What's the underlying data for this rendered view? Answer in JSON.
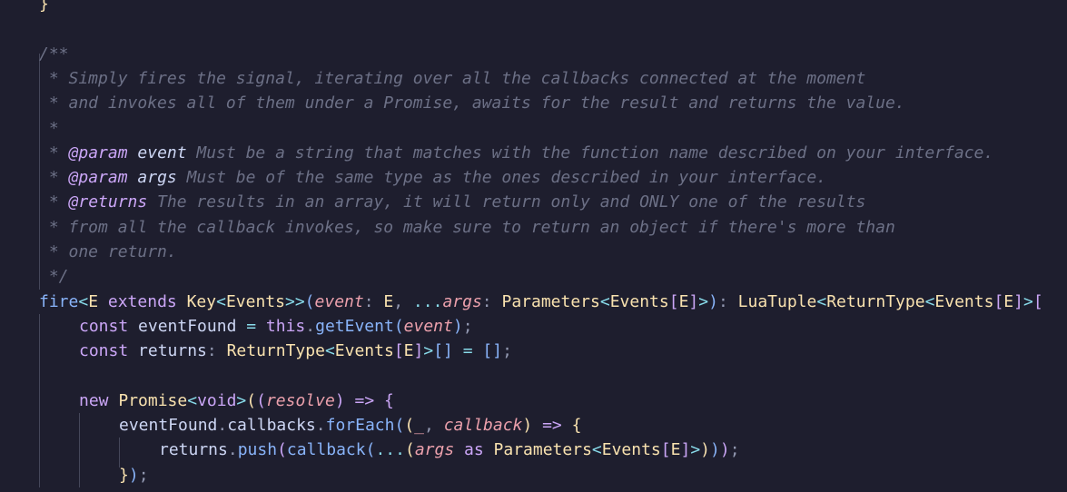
{
  "colors": {
    "background": "#1e1e2e",
    "comment": "#6c7086",
    "keyword": "#cba6f7",
    "function": "#89b4fa",
    "type": "#f9e2af",
    "parameter": "#eba0ac",
    "text": "#cdd6f4",
    "operator": "#89dceb"
  },
  "lines": [
    {
      "indent": 0,
      "tokens": [
        {
          "t": "}",
          "c": "tok-brace-y"
        }
      ]
    },
    {
      "indent": 0,
      "tokens": []
    },
    {
      "indent": 0,
      "tokens": [
        {
          "t": "/**",
          "c": "tok-comment"
        }
      ]
    },
    {
      "indent": 0,
      "tokens": [
        {
          "t": " * Simply fires the signal, iterating over all the callbacks connected at the moment",
          "c": "tok-comment"
        }
      ]
    },
    {
      "indent": 0,
      "tokens": [
        {
          "t": " * and invokes all of them under a Promise, awaits for the result and returns the value.",
          "c": "tok-comment"
        }
      ]
    },
    {
      "indent": 0,
      "tokens": [
        {
          "t": " *",
          "c": "tok-comment"
        }
      ]
    },
    {
      "indent": 0,
      "tokens": [
        {
          "t": " * ",
          "c": "tok-comment"
        },
        {
          "t": "@param",
          "c": "tok-tag"
        },
        {
          "t": " ",
          "c": "tok-comment"
        },
        {
          "t": "event",
          "c": "tok-param-name"
        },
        {
          "t": " Must be a string that matches with the function name described on your interface.",
          "c": "tok-comment"
        }
      ]
    },
    {
      "indent": 0,
      "tokens": [
        {
          "t": " * ",
          "c": "tok-comment"
        },
        {
          "t": "@param",
          "c": "tok-tag"
        },
        {
          "t": " ",
          "c": "tok-comment"
        },
        {
          "t": "args",
          "c": "tok-param-name"
        },
        {
          "t": " Must be of the same type as the ones described in your interface.",
          "c": "tok-comment"
        }
      ]
    },
    {
      "indent": 0,
      "tokens": [
        {
          "t": " * ",
          "c": "tok-comment"
        },
        {
          "t": "@returns",
          "c": "tok-tag"
        },
        {
          "t": " The results in an array, it will return only and ONLY one of the results",
          "c": "tok-comment"
        }
      ]
    },
    {
      "indent": 0,
      "tokens": [
        {
          "t": " * from all the callback invokes, so make sure to return an object if there's more than",
          "c": "tok-comment"
        }
      ]
    },
    {
      "indent": 0,
      "tokens": [
        {
          "t": " * one return.",
          "c": "tok-comment"
        }
      ]
    },
    {
      "indent": 0,
      "tokens": [
        {
          "t": " */",
          "c": "tok-comment"
        }
      ]
    },
    {
      "indent": 0,
      "tokens": [
        {
          "t": "fire",
          "c": "tok-function"
        },
        {
          "t": "<",
          "c": "tok-operator"
        },
        {
          "t": "E",
          "c": "tok-type"
        },
        {
          "t": " extends ",
          "c": "tok-keyword"
        },
        {
          "t": "Key",
          "c": "tok-type"
        },
        {
          "t": "<",
          "c": "tok-operator"
        },
        {
          "t": "Events",
          "c": "tok-type"
        },
        {
          "t": ">>",
          "c": "tok-operator"
        },
        {
          "t": "(",
          "c": "tok-brace-b"
        },
        {
          "t": "event",
          "c": "tok-param"
        },
        {
          "t": ": ",
          "c": "tok-punct"
        },
        {
          "t": "E",
          "c": "tok-type"
        },
        {
          "t": ", ",
          "c": "tok-punct"
        },
        {
          "t": "...",
          "c": "tok-operator"
        },
        {
          "t": "args",
          "c": "tok-param"
        },
        {
          "t": ": ",
          "c": "tok-punct"
        },
        {
          "t": "Parameters",
          "c": "tok-type"
        },
        {
          "t": "<",
          "c": "tok-operator"
        },
        {
          "t": "Events",
          "c": "tok-type"
        },
        {
          "t": "[",
          "c": "tok-brace-p"
        },
        {
          "t": "E",
          "c": "tok-type"
        },
        {
          "t": "]",
          "c": "tok-brace-p"
        },
        {
          "t": ">",
          "c": "tok-operator"
        },
        {
          "t": ")",
          "c": "tok-brace-b"
        },
        {
          "t": ": ",
          "c": "tok-punct"
        },
        {
          "t": "LuaTuple",
          "c": "tok-type"
        },
        {
          "t": "<",
          "c": "tok-operator"
        },
        {
          "t": "ReturnType",
          "c": "tok-type"
        },
        {
          "t": "<",
          "c": "tok-operator"
        },
        {
          "t": "Events",
          "c": "tok-type"
        },
        {
          "t": "[",
          "c": "tok-brace-p"
        },
        {
          "t": "E",
          "c": "tok-type"
        },
        {
          "t": "]",
          "c": "tok-brace-p"
        },
        {
          "t": ">",
          "c": "tok-operator"
        },
        {
          "t": "[",
          "c": "tok-brace-p"
        }
      ]
    },
    {
      "indent": 1,
      "tokens": [
        {
          "t": "const ",
          "c": "tok-keyword"
        },
        {
          "t": "eventFound",
          "c": "tok-plain"
        },
        {
          "t": " = ",
          "c": "tok-operator"
        },
        {
          "t": "this",
          "c": "tok-keyword"
        },
        {
          "t": ".",
          "c": "tok-punct"
        },
        {
          "t": "getEvent",
          "c": "tok-function"
        },
        {
          "t": "(",
          "c": "tok-brace-b"
        },
        {
          "t": "event",
          "c": "tok-param"
        },
        {
          "t": ")",
          "c": "tok-brace-b"
        },
        {
          "t": ";",
          "c": "tok-punct"
        }
      ]
    },
    {
      "indent": 1,
      "tokens": [
        {
          "t": "const ",
          "c": "tok-keyword"
        },
        {
          "t": "returns",
          "c": "tok-plain"
        },
        {
          "t": ": ",
          "c": "tok-punct"
        },
        {
          "t": "ReturnType",
          "c": "tok-type"
        },
        {
          "t": "<",
          "c": "tok-operator"
        },
        {
          "t": "Events",
          "c": "tok-type"
        },
        {
          "t": "[",
          "c": "tok-brace-p"
        },
        {
          "t": "E",
          "c": "tok-type"
        },
        {
          "t": "]",
          "c": "tok-brace-p"
        },
        {
          "t": ">",
          "c": "tok-operator"
        },
        {
          "t": "[]",
          "c": "tok-brace-b"
        },
        {
          "t": " = ",
          "c": "tok-operator"
        },
        {
          "t": "[]",
          "c": "tok-brace-b"
        },
        {
          "t": ";",
          "c": "tok-punct"
        }
      ]
    },
    {
      "indent": 1,
      "tokens": []
    },
    {
      "indent": 1,
      "tokens": [
        {
          "t": "new ",
          "c": "tok-keyword"
        },
        {
          "t": "Promise",
          "c": "tok-type"
        },
        {
          "t": "<",
          "c": "tok-operator"
        },
        {
          "t": "void",
          "c": "tok-keyword"
        },
        {
          "t": ">",
          "c": "tok-operator"
        },
        {
          "t": "(",
          "c": "tok-brace-y"
        },
        {
          "t": "(",
          "c": "tok-brace-p"
        },
        {
          "t": "resolve",
          "c": "tok-param"
        },
        {
          "t": ")",
          "c": "tok-brace-p"
        },
        {
          "t": " => ",
          "c": "tok-keyword"
        },
        {
          "t": "{",
          "c": "tok-brace-p"
        }
      ]
    },
    {
      "indent": 2,
      "tokens": [
        {
          "t": "eventFound",
          "c": "tok-plain"
        },
        {
          "t": ".",
          "c": "tok-punct"
        },
        {
          "t": "callbacks",
          "c": "tok-plain"
        },
        {
          "t": ".",
          "c": "tok-punct"
        },
        {
          "t": "forEach",
          "c": "tok-function"
        },
        {
          "t": "(",
          "c": "tok-brace-b"
        },
        {
          "t": "(",
          "c": "tok-brace-y"
        },
        {
          "t": "_",
          "c": "tok-param"
        },
        {
          "t": ", ",
          "c": "tok-punct"
        },
        {
          "t": "callback",
          "c": "tok-param"
        },
        {
          "t": ")",
          "c": "tok-brace-y"
        },
        {
          "t": " => ",
          "c": "tok-keyword"
        },
        {
          "t": "{",
          "c": "tok-brace-y"
        }
      ]
    },
    {
      "indent": 3,
      "tokens": [
        {
          "t": "returns",
          "c": "tok-plain"
        },
        {
          "t": ".",
          "c": "tok-punct"
        },
        {
          "t": "push",
          "c": "tok-function"
        },
        {
          "t": "(",
          "c": "tok-brace-p"
        },
        {
          "t": "callback",
          "c": "tok-function"
        },
        {
          "t": "(",
          "c": "tok-brace-b"
        },
        {
          "t": "...",
          "c": "tok-operator"
        },
        {
          "t": "(",
          "c": "tok-brace-y"
        },
        {
          "t": "args",
          "c": "tok-param"
        },
        {
          "t": " as ",
          "c": "tok-keyword"
        },
        {
          "t": "Parameters",
          "c": "tok-type"
        },
        {
          "t": "<",
          "c": "tok-operator"
        },
        {
          "t": "Events",
          "c": "tok-type"
        },
        {
          "t": "[",
          "c": "tok-brace-p"
        },
        {
          "t": "E",
          "c": "tok-type"
        },
        {
          "t": "]",
          "c": "tok-brace-p"
        },
        {
          "t": ">",
          "c": "tok-operator"
        },
        {
          "t": ")",
          "c": "tok-brace-y"
        },
        {
          "t": ")",
          "c": "tok-brace-b"
        },
        {
          "t": ")",
          "c": "tok-brace-p"
        },
        {
          "t": ";",
          "c": "tok-punct"
        }
      ]
    },
    {
      "indent": 2,
      "tokens": [
        {
          "t": "}",
          "c": "tok-brace-y"
        },
        {
          "t": ")",
          "c": "tok-brace-b"
        },
        {
          "t": ";",
          "c": "tok-punct"
        }
      ]
    }
  ]
}
